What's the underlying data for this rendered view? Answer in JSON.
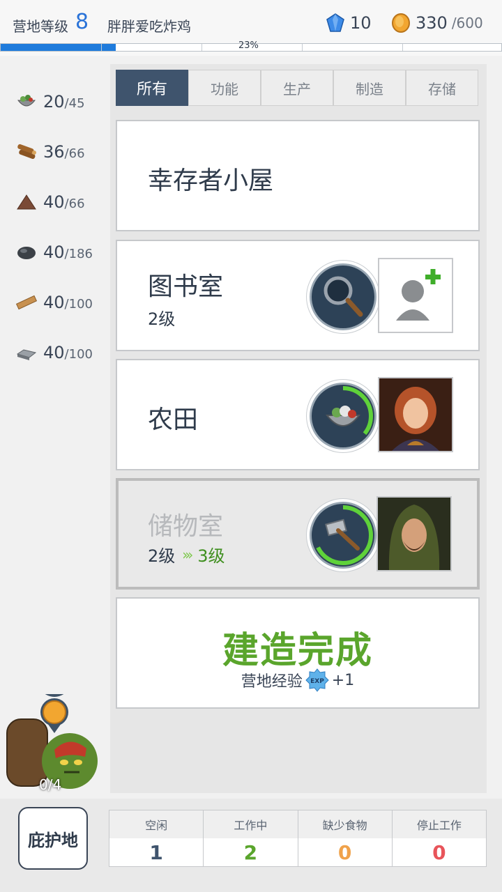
{
  "topbar": {
    "camp_level_label": "营地等级",
    "camp_level_value": "8",
    "player_name": "胖胖爱吃炸鸡",
    "gems": "10",
    "coins": "330",
    "coins_max": "/600",
    "xp_percent_text": "23%",
    "xp_fraction": 0.23
  },
  "resources": [
    {
      "icon": "salad-bowl-icon",
      "value": "20",
      "max": "/45"
    },
    {
      "icon": "wood-logs-icon",
      "value": "36",
      "max": "/66"
    },
    {
      "icon": "dirt-pile-icon",
      "value": "40",
      "max": "/66"
    },
    {
      "icon": "coal-icon",
      "value": "40",
      "max": "/186"
    },
    {
      "icon": "plank-icon",
      "value": "40",
      "max": "/100"
    },
    {
      "icon": "metal-ingot-icon",
      "value": "40",
      "max": "/100"
    }
  ],
  "tabs": [
    "所有",
    "功能",
    "生产",
    "制造",
    "存储"
  ],
  "buildings": {
    "survivor_hut": {
      "title": "幸存者小屋"
    },
    "library": {
      "title": "图书室",
      "level": "2级"
    },
    "farm": {
      "title": "农田"
    },
    "storage": {
      "title": "储物室",
      "level_from": "2级",
      "level_to": "3级"
    }
  },
  "construction": {
    "title": "建造完成",
    "exp_label": "营地经验",
    "exp_badge": "EXP",
    "exp_value": "+1"
  },
  "goblin": {
    "count": "0/4"
  },
  "bottom": {
    "shelter_label": "庇护地",
    "statuses": [
      {
        "label": "空闲",
        "value": "1",
        "color": "#3f546d"
      },
      {
        "label": "工作中",
        "value": "2",
        "color": "#5aa52c"
      },
      {
        "label": "缺少食物",
        "value": "0",
        "color": "#f0a24a"
      },
      {
        "label": "停止工作",
        "value": "0",
        "color": "#e8545a"
      }
    ]
  },
  "colors": {
    "accent_blue": "#1f7bdc",
    "tab_active": "#3f546d",
    "complete_green": "#5aa52c"
  }
}
